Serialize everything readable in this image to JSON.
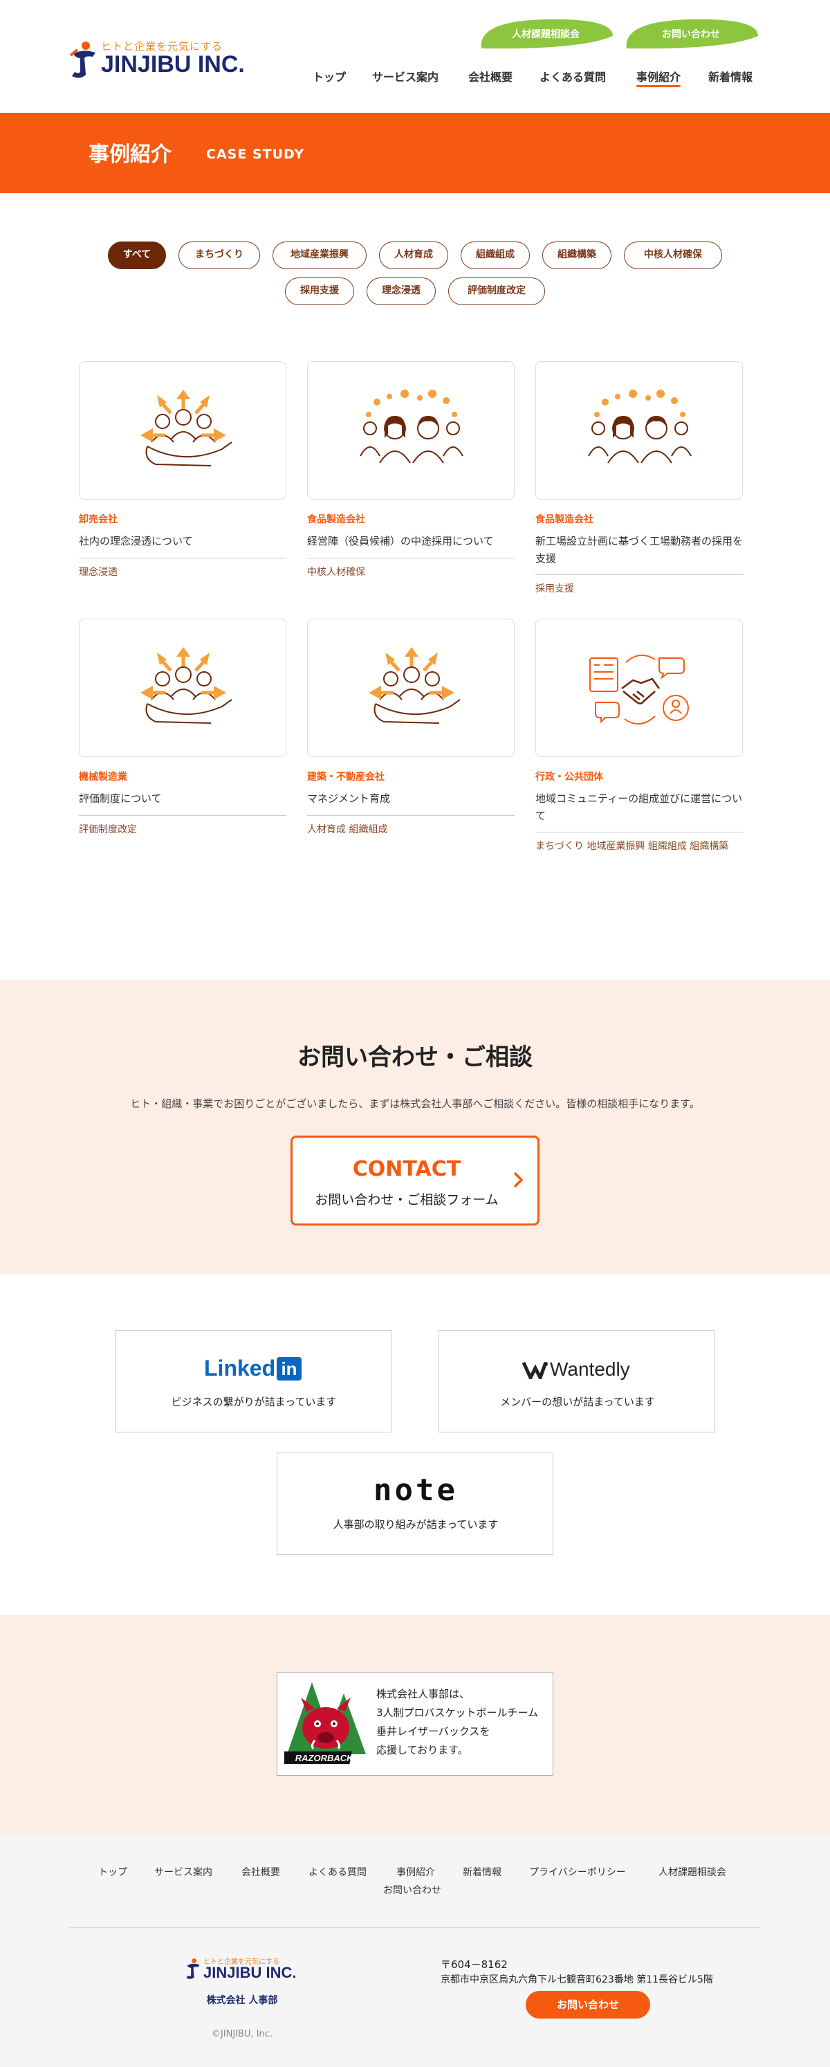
{
  "header": {
    "logo_tagline": "ヒトと企業を元気にする",
    "logo_name": "JINJIBU INC.",
    "top_buttons": [
      "人材課題相談会",
      "お問い合わせ"
    ],
    "nav": [
      "トップ",
      "サービス案内",
      "会社概要",
      "よくある質問",
      "事例紹介",
      "新着情報"
    ],
    "active_nav": "事例紹介"
  },
  "hero": {
    "title": "事例紹介",
    "subtitle": "CASE STUDY"
  },
  "filters": [
    "すべて",
    "まちづくり",
    "地域産業振興",
    "人材育成",
    "組織組成",
    "組織構築",
    "中核人材確保",
    "採用支援",
    "理念浸透",
    "評価制度改定"
  ],
  "active_filter": "すべて",
  "cases": [
    {
      "category": "卸売会社",
      "title": "社内の理念浸透について",
      "tags": [
        "理念浸透"
      ],
      "illustration": "hand-people-icon"
    },
    {
      "category": "食品製造会社",
      "title": "経営陣（役員候補）の中途採用について",
      "tags": [
        "中核人材確保"
      ],
      "illustration": "two-people-icon"
    },
    {
      "category": "食品製造会社",
      "title": "新工場設立計画に基づく工場勤務者の採用を支援",
      "tags": [
        "採用支援"
      ],
      "illustration": "two-people-icon"
    },
    {
      "category": "機械製造業",
      "title": "評価制度について",
      "tags": [
        "評価制度改定"
      ],
      "illustration": "hand-people-icon"
    },
    {
      "category": "建築・不動産会社",
      "title": "マネジメント育成",
      "tags": [
        "人材育成",
        "組織組成"
      ],
      "illustration": "hand-people-icon"
    },
    {
      "category": "行政・公共団体",
      "title": "地域コミュニティーの組成並びに運営について",
      "tags": [
        "まちづくり",
        "地域産業振興",
        "組織組成",
        "組織構築"
      ],
      "illustration": "handshake-icon"
    }
  ],
  "contact": {
    "heading": "お問い合わせ・ご相談",
    "text": "ヒト・組織・事業でお困りごとがございましたら、まずは株式会社人事部へご相談ください。皆様の相談相手になります。",
    "button_title": "CONTACT",
    "button_sub": "お問い合わせ・ご相談フォーム"
  },
  "sns": [
    {
      "logo": "Linked",
      "logo_badge": "in",
      "text": "ビジネスの繋がりが詰まっています"
    },
    {
      "logo": "Wantedly",
      "text": "メンバーの想いが詰まっています"
    },
    {
      "logo": "note",
      "text": "人事部の取り組みが詰まっています"
    }
  ],
  "sponsor": {
    "lines": [
      "株式会社人事部は、",
      "3人制プロバスケットボールチーム",
      "垂井レイザーバックスを",
      "応援しております。"
    ],
    "logo_text": "RAZORBACKS"
  },
  "footer": {
    "nav_row1": [
      "トップ",
      "サービス案内",
      "会社概要",
      "よくある質問",
      "事例紹介",
      "新着情報",
      "プライバシーポリシー",
      "人材課題相談会"
    ],
    "nav_row2": [
      "お問い合わせ"
    ],
    "company": "株式会社 人事部",
    "postal": "〒604－8162",
    "address": "京都市中京区烏丸六角下ル七観音町623番地 第11長谷ビル5階",
    "button": "お問い合わせ",
    "copyright": "©JINJIBU, Inc."
  },
  "colors": {
    "accent": "#f55a10",
    "green": "#8cc63f",
    "brown": "#6b2707",
    "peach": "#fdeee5",
    "navy": "#1e2a6e"
  }
}
